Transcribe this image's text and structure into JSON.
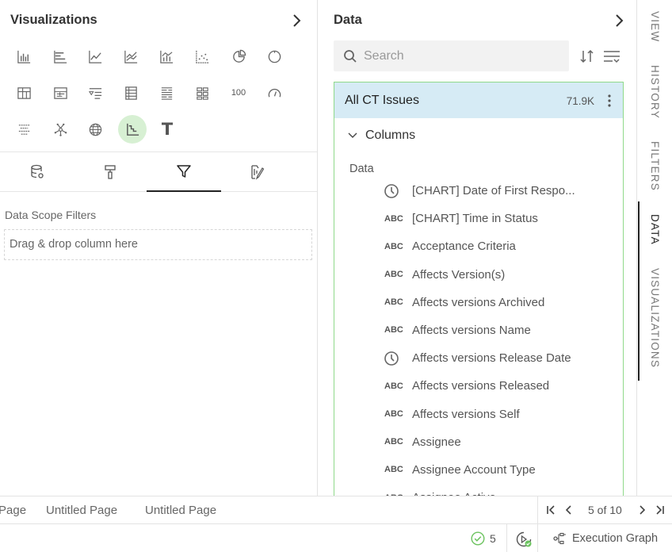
{
  "visualizations": {
    "title": "Visualizations",
    "icons_row1": [
      "bar-chart-icon",
      "horizontal-bar-icon",
      "line-chart-icon",
      "area-chart-icon",
      "combo-chart-icon",
      "scatter-chart-icon",
      "pie-chart-icon",
      "donut-chart-icon"
    ],
    "icons_row2": [
      "pivot-table-icon",
      "table-detail-icon",
      "filter-list-icon",
      "table-icon",
      "grouped-table-icon",
      "tile-grid-icon",
      "number-kpi-icon",
      "gauge-icon"
    ],
    "icons_row3": [
      "funnel-list-icon",
      "network-icon",
      "globe-map-icon",
      "step-chart-icon",
      "text-icon"
    ],
    "number_label": "100",
    "text_label": "T",
    "active_icon": "step-chart-icon",
    "active_color": "#d7f0d3",
    "tabs": [
      "data-tab",
      "format-tab",
      "filter-tab",
      "style-tab"
    ],
    "active_tab": "filter-tab",
    "scope_label": "Data Scope Filters",
    "drop_placeholder": "Drag & drop column here"
  },
  "data_panel": {
    "title": "Data",
    "search_placeholder": "Search",
    "dataset": {
      "name": "All CT Issues",
      "count": "71.9K",
      "header_color": "#d6ebf5",
      "border_color": "#8fd98a"
    },
    "columns_label": "Columns",
    "group_label": "Data",
    "columns": [
      {
        "type": "clock",
        "name": "[CHART] Date of First Respo..."
      },
      {
        "type": "ABC",
        "name": "[CHART] Time in Status"
      },
      {
        "type": "ABC",
        "name": "Acceptance Criteria"
      },
      {
        "type": "ABC",
        "name": "Affects Version(s)"
      },
      {
        "type": "ABC",
        "name": "Affects versions Archived"
      },
      {
        "type": "ABC",
        "name": "Affects versions Name"
      },
      {
        "type": "clock",
        "name": "Affects versions Release Date"
      },
      {
        "type": "ABC",
        "name": "Affects versions Released"
      },
      {
        "type": "ABC",
        "name": "Affects versions Self"
      },
      {
        "type": "ABC",
        "name": "Assignee"
      },
      {
        "type": "ABC",
        "name": "Assignee Account Type"
      },
      {
        "type": "ABC",
        "name": "Assignee Active"
      }
    ]
  },
  "side_tabs": [
    {
      "label": "VIEW"
    },
    {
      "label": "HISTORY"
    },
    {
      "label": "FILTERS"
    },
    {
      "label": "DATA",
      "active": true
    },
    {
      "label": "VISUALIZATIONS"
    }
  ],
  "page_tabs": [
    "Page",
    "Untitled Page",
    "Untitled Page"
  ],
  "pager": {
    "text": "5 of 10"
  },
  "status": {
    "ok_count": "5",
    "ok_color": "#6cc35f",
    "exec_graph_label": "Execution Graph"
  }
}
